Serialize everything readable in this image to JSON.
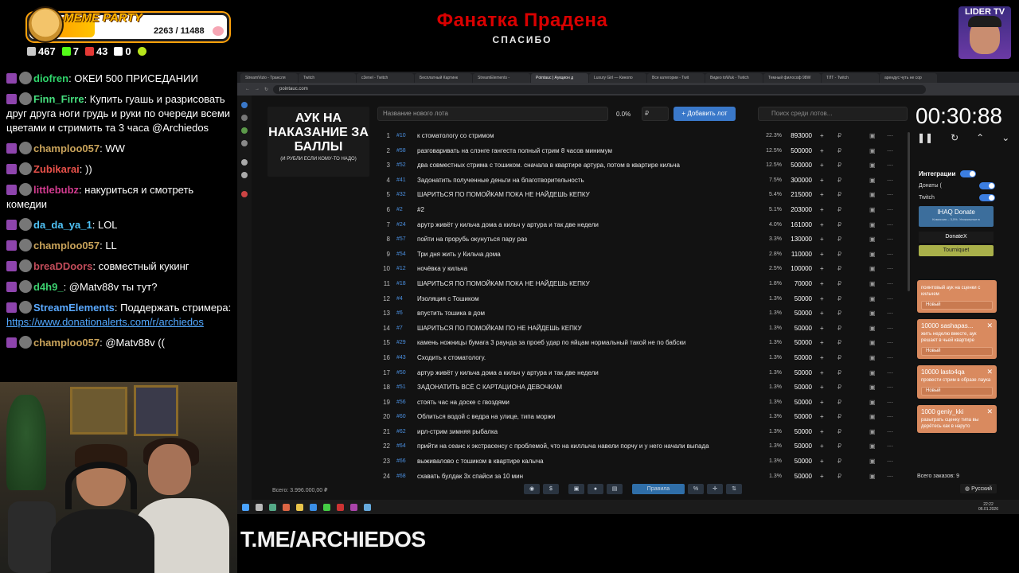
{
  "overlay": {
    "meme_party": {
      "title": "MEME PARTY",
      "count": "2263 / 11488"
    },
    "stats": [
      {
        "icon": "points-icon",
        "value": "467",
        "color": "#c9c9c9"
      },
      {
        "icon": "kick-icon",
        "value": "7",
        "color": "#53fc18"
      },
      {
        "icon": "vk-icon",
        "value": "43",
        "color": "#e53935"
      },
      {
        "icon": "w-icon",
        "value": "0",
        "color": "#ffffff"
      },
      {
        "icon": "d-icon",
        "value": "",
        "color": "#b8e61c"
      }
    ],
    "stream_title": "Фанатка Прадена",
    "stream_subtitle": "СПАСИБО",
    "lider_label": "LIDER TV",
    "tme": "T.ME/ARCHIEDOS"
  },
  "chat": [
    {
      "name": "diofren",
      "color": "#2fd56b",
      "text": ": ОКЕИ 500 ПРИСЕДАНИИ"
    },
    {
      "name": "Finn_Firre",
      "color": "#46e07e",
      "text": ": Купить гуашь и разрисовать друг друга ноги грудь и руки по очереди всеми цветами и стримить та 3 часа @Archiedos"
    },
    {
      "name": "champloo057",
      "color": "#c9a35a",
      "text": ": WW"
    },
    {
      "name": "Zubikarai",
      "color": "#e8514a",
      "text": ": ))"
    },
    {
      "name": "littlebubz",
      "color": "#d23b8f",
      "text": ": накуриться и смотреть комедии"
    },
    {
      "name": "da_da_ya_1",
      "color": "#4fc3f7",
      "text": ": LOL"
    },
    {
      "name": "champloo057",
      "color": "#c9a35a",
      "text": ": LL"
    },
    {
      "name": "breaDDoors",
      "color": "#c24c5a",
      "text": ": совместный кукинг"
    },
    {
      "name": "d4h9_",
      "color": "#3ccf6f",
      "text": ": @Matv88v ты тут?"
    },
    {
      "name": "StreamElements",
      "color": "#5aa9ff",
      "text": ": Поддержать стримера: ",
      "link": "https://www.donationalerts.com/r/archiedos"
    },
    {
      "name": "champloo057",
      "color": "#c9a35a",
      "text": ": @Matv88v (("
    }
  ],
  "browser": {
    "tabs": [
      "StreamVizio - Трансля",
      "Twitch",
      "c3enel - Twitch",
      "Бесплатный Картинк",
      "StreamElements - ",
      "Pointauc | Аукцион д",
      "Luxury Girl — Кинопо",
      "Все категории - Twit",
      "Видео toWuk - Twitch",
      "Темный философ 98W",
      "ТЛТ - Twitch",
      "арендус чуть не сор"
    ],
    "address": "pointauc.com"
  },
  "auction": {
    "title": "АУК НА НАКАЗАНИЕ ЗА БАЛЛЫ",
    "subtitle": "(И РУБЛИ ЕСЛИ КОМУ-ТО НАДО)",
    "lot_placeholder": "Название нового лота",
    "percent": "0.0%",
    "currency": "₽",
    "add_button": "Добавить лот",
    "search_placeholder": "Поиск среди лотов...",
    "timer": "00:30:88",
    "total": "Всего: 3.996.000,00 ₽",
    "rules_button": "Правила",
    "orders": "Всего заказов: 9",
    "language": "Русский",
    "lots": [
      {
        "n": "1",
        "id": "#10",
        "name": "к стоматологу со стримом",
        "pct": "22.3%",
        "amount": "893000"
      },
      {
        "n": "2",
        "id": "#58",
        "name": "разговаривать на слэнге гангеста полный стрим 8 часов минимум",
        "pct": "12.5%",
        "amount": "500000"
      },
      {
        "n": "3",
        "id": "#52",
        "name": "два совместных стрима с тошиком. сначала в квартире артура, потом в квартире кильча",
        "pct": "12.5%",
        "amount": "500000"
      },
      {
        "n": "4",
        "id": "#41",
        "name": "Задонатить полученные деньги на благотворительность",
        "pct": "7.5%",
        "amount": "300000"
      },
      {
        "n": "5",
        "id": "#32",
        "name": "ШАРИТЬСЯ ПО ПОМОЙКАМ ПОКА НЕ НАЙДЕШЬ КЕПКУ",
        "pct": "5.4%",
        "amount": "215000"
      },
      {
        "n": "6",
        "id": "#2",
        "name": "#2",
        "pct": "5.1%",
        "amount": "203000"
      },
      {
        "n": "7",
        "id": "#24",
        "name": "арутр живёт у кильча дома а кильч у артура и так две недели",
        "pct": "4.0%",
        "amount": "161000"
      },
      {
        "n": "8",
        "id": "#57",
        "name": "пойти на прорубь окунуться пару раз",
        "pct": "3.3%",
        "amount": "130000"
      },
      {
        "n": "9",
        "id": "#54",
        "name": "Три дня жить у Кильча дома",
        "pct": "2.8%",
        "amount": "110000"
      },
      {
        "n": "10",
        "id": "#12",
        "name": "ночёвка у кильча",
        "pct": "2.5%",
        "amount": "100000"
      },
      {
        "n": "11",
        "id": "#18",
        "name": "ШАРИТЬСЯ ПО ПОМОЙКАМ ПОКА НЕ НАЙДЕШЬ КЕПКУ",
        "pct": "1.8%",
        "amount": "70000"
      },
      {
        "n": "12",
        "id": "#4",
        "name": "Изоляция с Тошиком",
        "pct": "1.3%",
        "amount": "50000"
      },
      {
        "n": "13",
        "id": "#6",
        "name": "впустить тошика в дом",
        "pct": "1.3%",
        "amount": "50000"
      },
      {
        "n": "14",
        "id": "#7",
        "name": "ШАРИТЬСЯ ПО ПОМОЙКАМ ПО НЕ НАЙДЕШЬ КЕПКУ",
        "pct": "1.3%",
        "amount": "50000"
      },
      {
        "n": "15",
        "id": "#29",
        "name": "камень ножницы бумага 3 раунда за проеб удар по яйцам нормальный такой не по бабски",
        "pct": "1.3%",
        "amount": "50000"
      },
      {
        "n": "16",
        "id": "#43",
        "name": "Сходить к стоматологу.",
        "pct": "1.3%",
        "amount": "50000"
      },
      {
        "n": "17",
        "id": "#50",
        "name": "артур живёт у кильча дома а кильч у артура и так две недели",
        "pct": "1.3%",
        "amount": "50000"
      },
      {
        "n": "18",
        "id": "#51",
        "name": "ЗАДОНАТИТЬ ВСЁ С КАРТАЦИОНА ДЕВОЧКАМ",
        "pct": "1.3%",
        "amount": "50000"
      },
      {
        "n": "19",
        "id": "#56",
        "name": "стоять час на доске с гвоздями",
        "pct": "1.3%",
        "amount": "50000"
      },
      {
        "n": "20",
        "id": "#60",
        "name": "Облиться водой с ведра на улице, типа моржи",
        "pct": "1.3%",
        "amount": "50000"
      },
      {
        "n": "21",
        "id": "#62",
        "name": "ирл-стрим зимняя рыбалка",
        "pct": "1.3%",
        "amount": "50000"
      },
      {
        "n": "22",
        "id": "#64",
        "name": "прийти на сеанс к экстрасенсу с проблемой, что на киллыча навели порчу и у него начали выпада",
        "pct": "1.3%",
        "amount": "50000"
      },
      {
        "n": "23",
        "id": "#66",
        "name": "выживалово с тошиком в квартире калыча",
        "pct": "1.3%",
        "amount": "50000"
      },
      {
        "n": "24",
        "id": "#68",
        "name": "схавать булдак 3х спайси за 10 мин",
        "pct": "1.3%",
        "amount": "50000"
      }
    ],
    "integrations": {
      "title": "Интеграции",
      "donations": "Донаты (",
      "twitch": "Twitch",
      "ihaq": "IHAQ Donate",
      "ihaq_sub": "Комиссия – 3,5%. Уникальные в",
      "donatex": "DonateX",
      "tourniquet": "Tourniquet"
    },
    "cards": [
      {
        "title": "",
        "desc": "поинтовый аук на сценки с кильчем",
        "status": "Новый"
      },
      {
        "title": "10000 sashapas...",
        "desc": "жить неделю вместе, аук решает в чьей квартире",
        "status": "Новый"
      },
      {
        "title": "10000 lasto4qa",
        "desc": "провести стрим в образе лаука",
        "status": "Новый"
      },
      {
        "title": "1000 geniy_kki",
        "desc": "разыграть сценку типа вы дерётесь как в наруто",
        "status": ""
      }
    ]
  },
  "taskbar": {
    "time": "22:22",
    "date": "06.01.2026"
  }
}
